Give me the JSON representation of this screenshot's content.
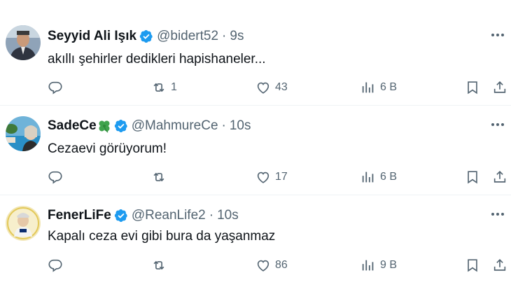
{
  "tweets": [
    {
      "name": "Seyyid Ali Işık",
      "handle": "@bidert52",
      "separator": "·",
      "time": "9s",
      "text": "akıllı şehirler dedikleri hapishaneler...",
      "replies": "",
      "retweets": "1",
      "likes": "43",
      "views": "6 B",
      "verified_color": "#1d9bf0"
    },
    {
      "name": "SadeCe",
      "name_emoji": "four-leaf-clover-icon",
      "handle": "@MahmureCe",
      "separator": "·",
      "time": "10s",
      "text": "Cezaevi görüyorum!",
      "replies": "",
      "retweets": "",
      "likes": "17",
      "views": "6 B",
      "verified_color": "#1d9bf0"
    },
    {
      "name": "FenerLiFe",
      "handle": "@ReanLife2",
      "separator": "·",
      "time": "10s",
      "text": "Kapalı ceza evi gibi bura da yaşanmaz",
      "replies": "",
      "retweets": "",
      "likes": "86",
      "views": "9 B",
      "verified_color": "#1d9bf0"
    }
  ],
  "colors": {
    "text": "#0f1419",
    "muted": "#536471",
    "accent": "#1d9bf0",
    "divider": "#eff3f4"
  }
}
